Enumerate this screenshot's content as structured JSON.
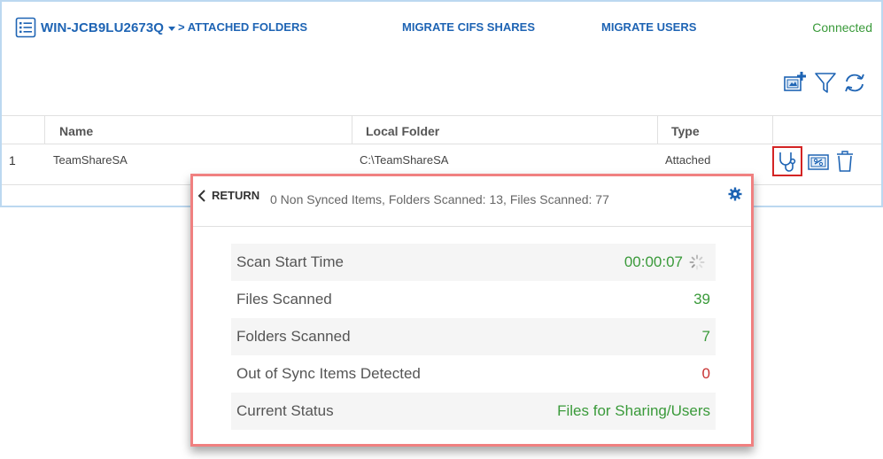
{
  "header": {
    "server_name": "WIN-JCB9LU2673Q",
    "nav": {
      "attached": "> ATTACHED FOLDERS",
      "cifs": "MIGRATE CIFS SHARES",
      "users": "MIGRATE USERS"
    },
    "connection_status": "Connected"
  },
  "table": {
    "columns": {
      "name": "Name",
      "local": "Local Folder",
      "type": "Type"
    },
    "rows": [
      {
        "index": "1",
        "name": "TeamShareSA",
        "local": "C:\\TeamShareSA",
        "type": "Attached"
      }
    ]
  },
  "popup": {
    "return_label": "RETURN",
    "summary": "0 Non Synced Items, Folders Scanned: 13, Files Scanned: 77",
    "stats": {
      "scan_start": {
        "label": "Scan Start Time",
        "value": "00:00:07"
      },
      "files": {
        "label": "Files Scanned",
        "value": "39"
      },
      "folders": {
        "label": "Folders Scanned",
        "value": "7"
      },
      "out_of_sync": {
        "label": "Out of Sync Items Detected",
        "value": "0"
      },
      "status": {
        "label": "Current Status",
        "value": "Files for Sharing/Users"
      }
    }
  },
  "colors": {
    "accent": "#1e64b4",
    "connected": "#3a9a3a",
    "highlight_border": "#d42424",
    "popup_border": "#f08080",
    "value_red": "#c83232"
  },
  "icons": {
    "server_menu": "list-icon",
    "add_folder": "add-folder-icon",
    "filter": "filter-icon",
    "refresh": "refresh-icon",
    "diagnose": "stethoscope-icon",
    "attach": "folder-link-icon",
    "delete": "trash-icon",
    "return": "chevron-left-icon",
    "settings": "gear-icon",
    "loading": "spinner-icon"
  }
}
